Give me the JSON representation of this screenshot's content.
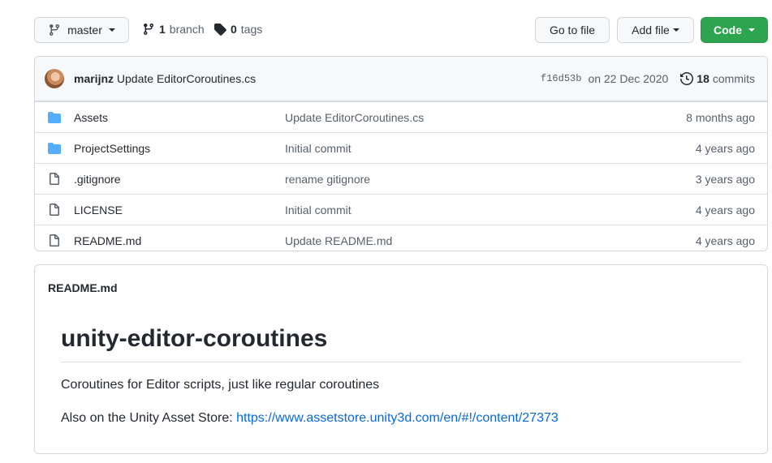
{
  "branch_selector": {
    "label": "master"
  },
  "branches": {
    "count": "1",
    "label": "branch"
  },
  "tags": {
    "count": "0",
    "label": "tags"
  },
  "actions": {
    "go_to_file": "Go to file",
    "add_file": "Add file",
    "code": "Code"
  },
  "latest_commit": {
    "author": "marijnz",
    "message": "Update EditorCoroutines.cs",
    "sha": "f16d53b",
    "date": "on 22 Dec 2020",
    "commits_count": "18",
    "commits_label": "commits"
  },
  "files": [
    {
      "type": "folder",
      "name": "Assets",
      "message": "Update EditorCoroutines.cs",
      "age": "8 months ago"
    },
    {
      "type": "folder",
      "name": "ProjectSettings",
      "message": "Initial commit",
      "age": "4 years ago"
    },
    {
      "type": "file",
      "name": ".gitignore",
      "message": "rename gitignore",
      "age": "3 years ago"
    },
    {
      "type": "file",
      "name": "LICENSE",
      "message": "Initial commit",
      "age": "4 years ago"
    },
    {
      "type": "file",
      "name": "README.md",
      "message": "Update README.md",
      "age": "4 years ago"
    }
  ],
  "readme": {
    "filename": "README.md",
    "title": "unity-editor-coroutines",
    "description": "Coroutines for Editor scripts, just like regular coroutines",
    "store_prefix": "Also on the Unity Asset Store: ",
    "store_link": "https://www.assetstore.unity3d.com/en/#!/content/27373"
  },
  "colors": {
    "primary": "#2da44e",
    "link": "#0969da",
    "folder": "#54aeff",
    "border": "#d0d7de"
  }
}
